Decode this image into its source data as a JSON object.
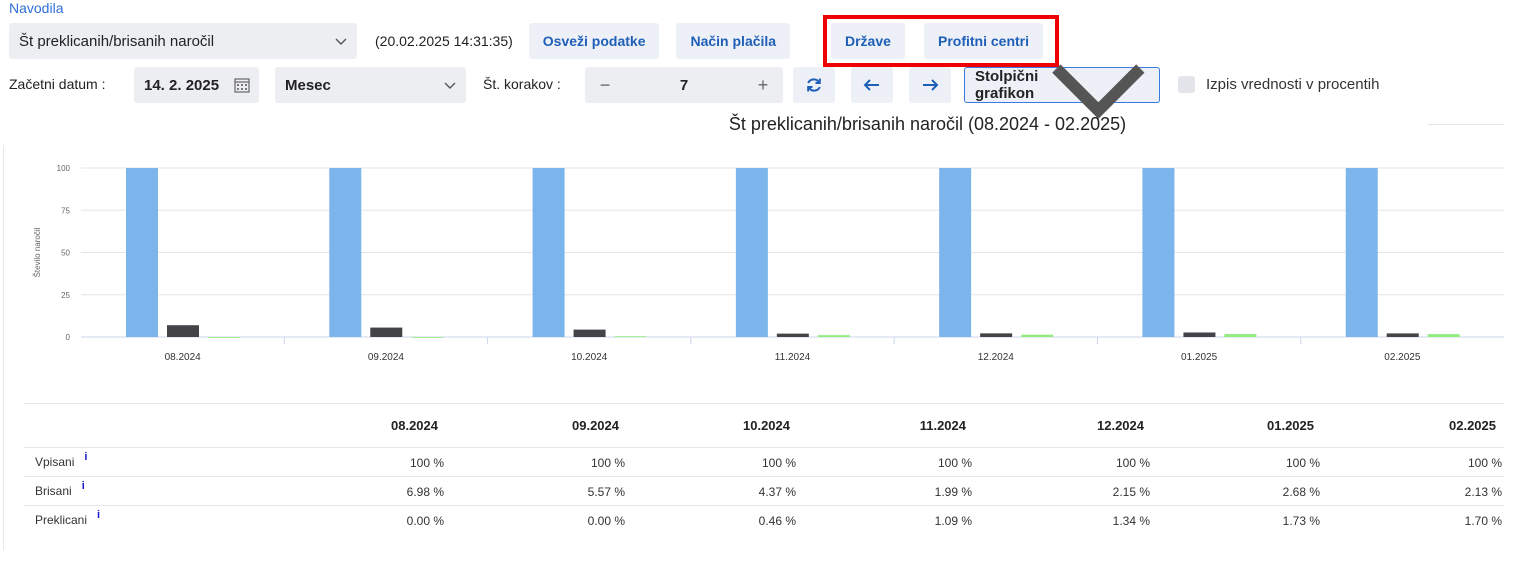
{
  "header": {
    "help_link": "Navodila"
  },
  "toolbar": {
    "report_select": "Št preklicanih/brisanih naročil",
    "timestamp": "(20.02.2025 14:31:35)",
    "refresh_label": "Osveži podatke",
    "payment_label": "Način plačila",
    "states_label": "Države",
    "profit_centers_label": "Profitni centri",
    "start_date_label": "Začetni datum :",
    "start_date_value": "14. 2. 2025",
    "period_select": "Mesec",
    "steps_label": "Št. korakov :",
    "steps_minus": "−",
    "steps_value": "7",
    "steps_plus": "+",
    "chart_type_select": "Stolpični grafikon",
    "percent_label": "Izpis vrednosti v procentih",
    "percent_checked": false
  },
  "chart_data": {
    "type": "bar",
    "title": "Št preklicanih/brisanih naročil (08.2024 - 02.2025)",
    "ylabel": "Število naročil",
    "ylim": [
      0,
      100
    ],
    "yticks": [
      0,
      25,
      50,
      75,
      100
    ],
    "grid": true,
    "categories": [
      "08.2024",
      "09.2024",
      "10.2024",
      "11.2024",
      "12.2024",
      "01.2025",
      "02.2025"
    ],
    "series": [
      {
        "key": "vpisani",
        "color": "#7cb5ec",
        "values": [
          100,
          100,
          100,
          100,
          100,
          100,
          100
        ]
      },
      {
        "key": "brisani",
        "color": "#434348",
        "values": [
          6.98,
          5.57,
          4.37,
          1.99,
          2.15,
          2.68,
          2.13
        ]
      },
      {
        "key": "preklicani",
        "color": "#90ed7d",
        "values": [
          0.0,
          0.0,
          0.46,
          1.09,
          1.34,
          1.73,
          1.7
        ]
      }
    ]
  },
  "table": {
    "columns": [
      "08.2024",
      "09.2024",
      "10.2024",
      "11.2024",
      "12.2024",
      "01.2025",
      "02.2025"
    ],
    "info_glyph": "i",
    "rows": [
      {
        "label": "Vpisani",
        "values": [
          "100 %",
          "100 %",
          "100 %",
          "100 %",
          "100 %",
          "100 %",
          "100 %"
        ]
      },
      {
        "label": "Brisani",
        "values": [
          "6.98 %",
          "5.57 %",
          "4.37 %",
          "1.99 %",
          "2.15 %",
          "2.68 %",
          "2.13 %"
        ]
      },
      {
        "label": "Preklicani",
        "values": [
          "0.00 %",
          "0.00 %",
          "0.46 %",
          "1.09 %",
          "1.34 %",
          "1.73 %",
          "1.70 %"
        ]
      }
    ]
  },
  "colors": {
    "accent": "#1f5fb8",
    "highlight": "#ee0000",
    "link": "#2f6fdc"
  }
}
